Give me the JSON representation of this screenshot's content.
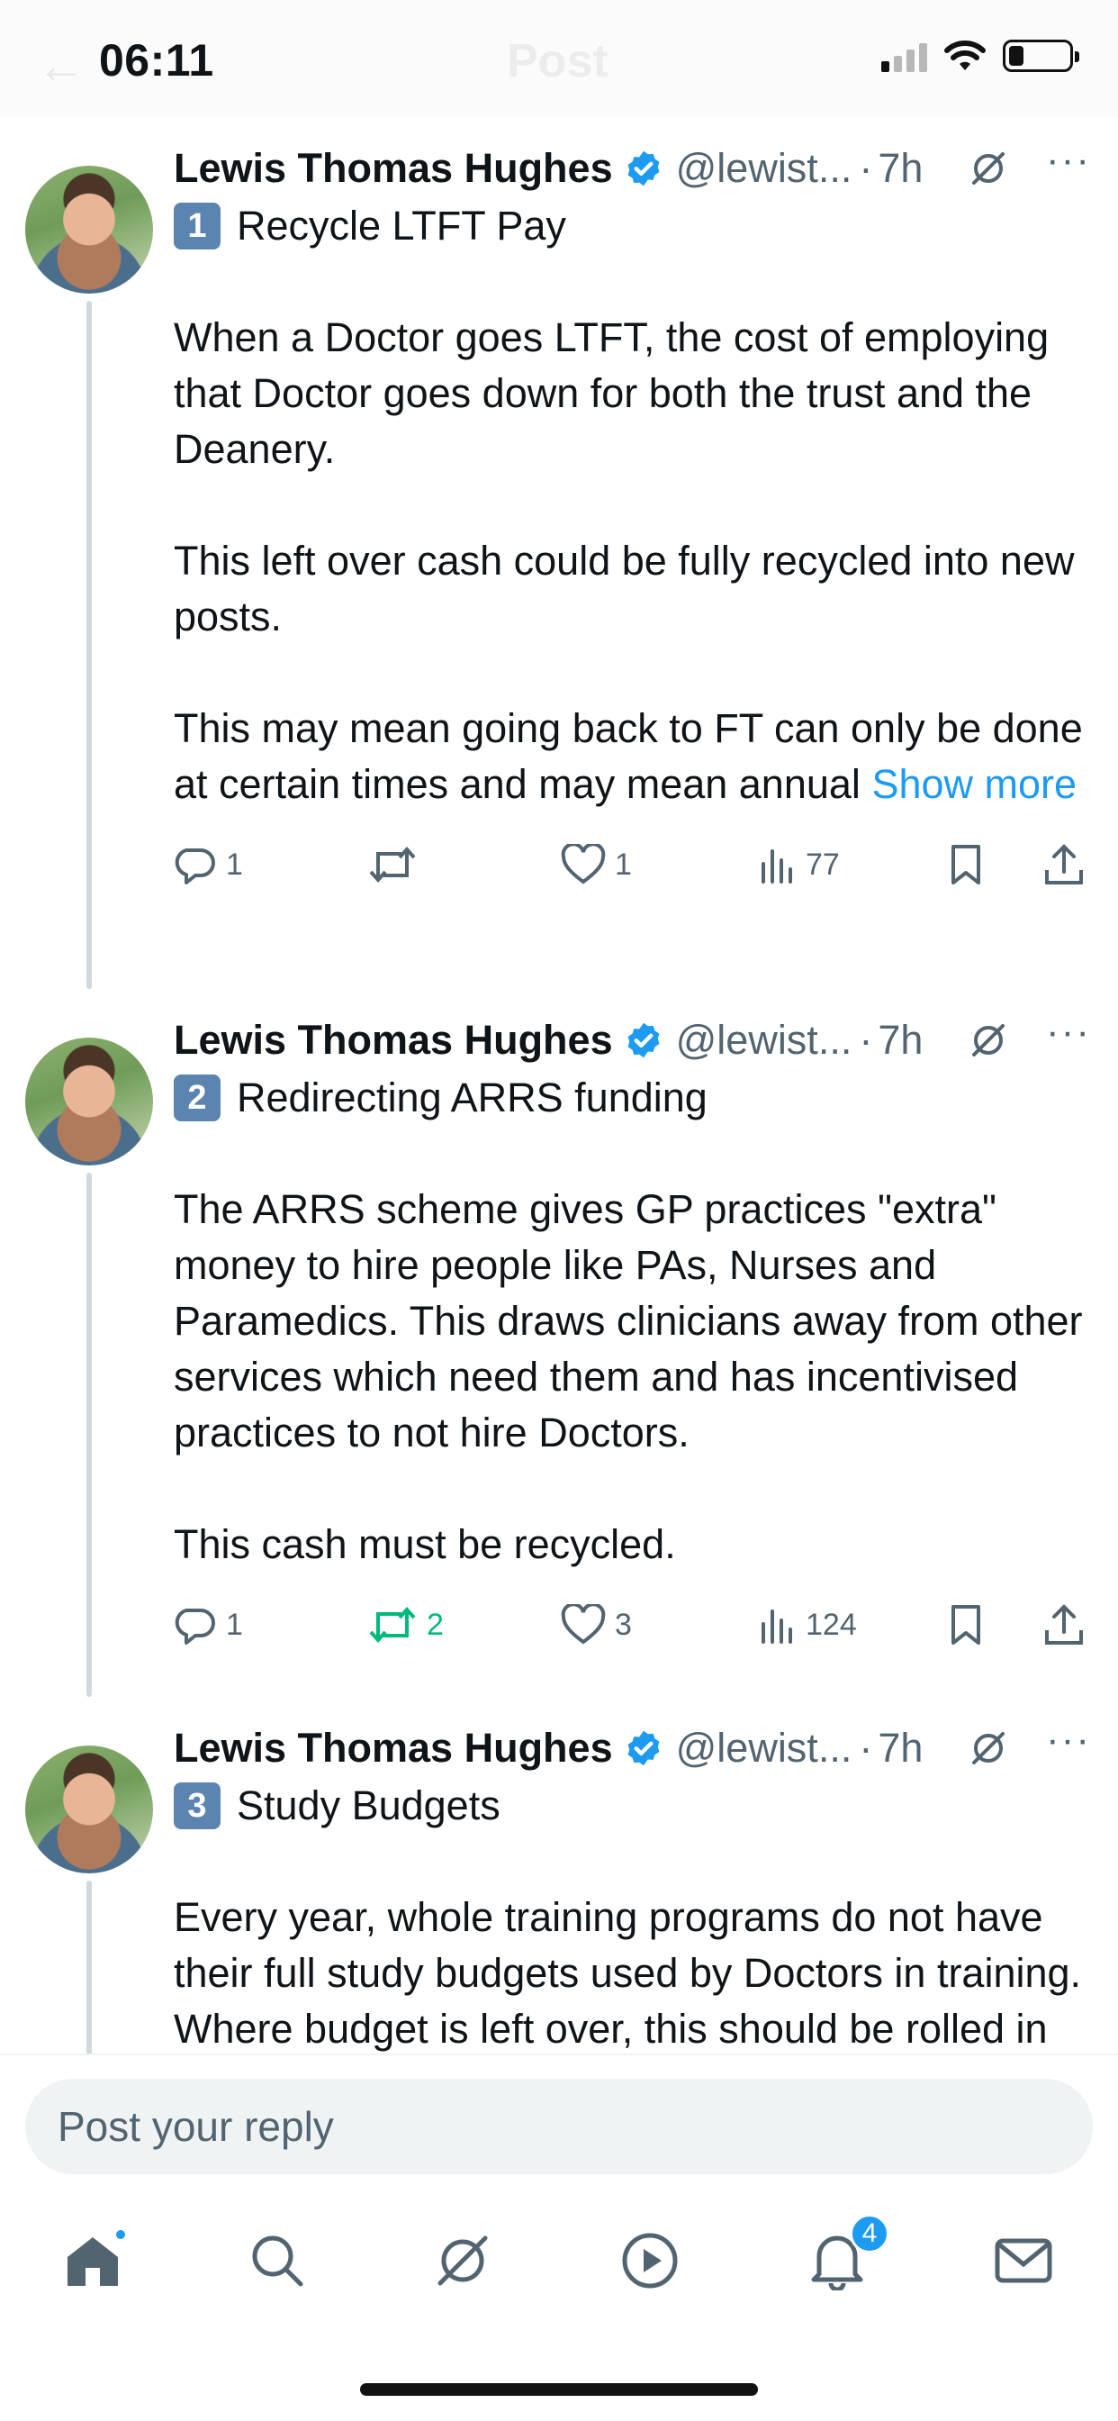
{
  "status_bar": {
    "time": "06:11"
  },
  "nav": {
    "back_icon": "arrow-left-icon",
    "title": "Post"
  },
  "posts": [
    {
      "author": "Lewis Thomas Hughes",
      "handle": "@lewist...",
      "sep": "·",
      "time": "7h",
      "title_num": "1",
      "title": "Recycle LTFT Pay",
      "paragraphs": [
        "When a Doctor goes LTFT, the cost of employing that Doctor goes down for both the trust and the Deanery.",
        "This left over cash could be fully recycled into new posts.",
        "This may mean going back to FT can only be done at certain times and may mean annual"
      ],
      "show_more": "Show more",
      "replies": "1",
      "reposts": "",
      "likes": "1",
      "views": "77"
    },
    {
      "author": "Lewis Thomas Hughes",
      "handle": "@lewist...",
      "sep": "·",
      "time": "7h",
      "title_num": "2",
      "title": "Redirecting ARRS funding",
      "paragraphs": [
        "The ARRS scheme gives GP practices \"extra\" money to hire people like PAs, Nurses and Paramedics. This draws clinicians away from other services which need them and has incentivised practices to not hire Doctors.",
        "This cash must be recycled."
      ],
      "replies": "1",
      "reposts": "2",
      "likes": "3",
      "views": "124"
    },
    {
      "author": "Lewis Thomas Hughes",
      "handle": "@lewist...",
      "sep": "·",
      "time": "7h",
      "title_num": "3",
      "title": "Study Budgets",
      "paragraphs": [
        "Every year, whole training programs do not have their full study budgets used by Doctors in training. Where budget is left over, this should be rolled in to the next financial year to"
      ]
    }
  ],
  "reply": {
    "placeholder": "Post your reply"
  },
  "tabbar": {
    "notifications_badge": "4",
    "active_tab": "home"
  },
  "colors": {
    "accent": "#1d9bf0",
    "repost_active": "#00ba7c",
    "muted": "#536471",
    "keycap": "#5b84b1"
  }
}
